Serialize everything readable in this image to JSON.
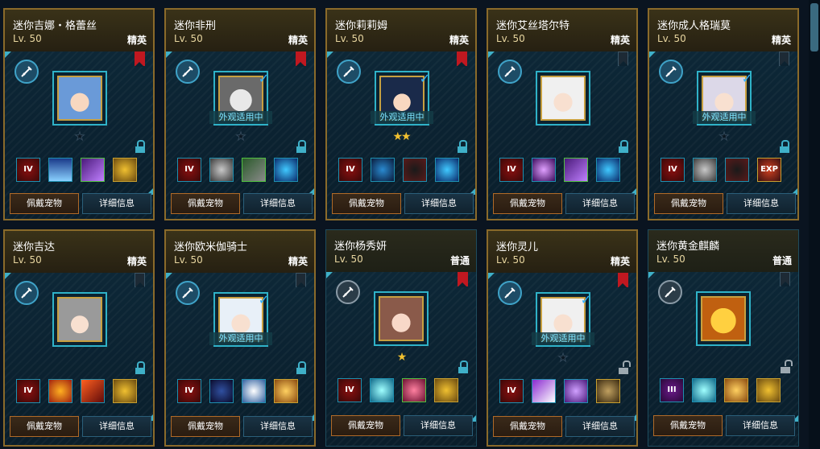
{
  "button_labels": {
    "equip": "佩戴宠物",
    "detail": "详细信息"
  },
  "applied_label": "外观适用中",
  "colors": {
    "accent": "#3fb0c8",
    "elite_border": "#8a6a2a",
    "red_ribbon": "#c01820",
    "star": "#f0c030"
  },
  "pets": [
    {
      "name": "迷你吉娜・格蕾丝",
      "level": "Lv. 50",
      "rank": "精英",
      "applied": false,
      "ribbon": "red",
      "stars": [
        false
      ],
      "lock": "closed",
      "class_icon": "sword-class-icon",
      "portrait": "blue-haired-girl",
      "skills": [
        {
          "icon": "rank-iv-icon",
          "text": "IV"
        },
        {
          "icon": "ice-spikes-skill-icon",
          "text": ""
        },
        {
          "icon": "purple-claw-skill-icon",
          "text": ""
        },
        {
          "icon": "gold-coin-skill-icon",
          "text": ""
        }
      ]
    },
    {
      "name": "迷你非刑",
      "level": "Lv. 50",
      "rank": "精英",
      "applied": true,
      "ribbon": "red",
      "stars": [
        false
      ],
      "lock": "closed",
      "class_icon": "sword-class-icon",
      "portrait": "masked-warrior",
      "skills": [
        {
          "icon": "rank-iv-icon",
          "text": "IV"
        },
        {
          "icon": "ghost-skill-icon",
          "text": ""
        },
        {
          "icon": "beast-skill-icon",
          "text": ""
        },
        {
          "icon": "blue-orb-skill-icon",
          "text": ""
        }
      ]
    },
    {
      "name": "迷你莉莉姆",
      "level": "Lv. 50",
      "rank": "精英",
      "applied": true,
      "ribbon": "red",
      "stars": [
        true,
        true
      ],
      "lock": "closed",
      "class_icon": "sword-class-icon",
      "portrait": "maid-girl",
      "skills": [
        {
          "icon": "rank-iv-icon",
          "text": "IV"
        },
        {
          "icon": "blue-swirl-skill-icon",
          "text": ""
        },
        {
          "icon": "shadow-silhouette-skill-icon",
          "text": ""
        },
        {
          "icon": "blue-orb-skill-icon",
          "text": ""
        }
      ]
    },
    {
      "name": "迷你艾丝塔尔特",
      "level": "Lv. 50",
      "rank": "精英",
      "applied": false,
      "ribbon": "dark",
      "stars": [],
      "lock": "closed",
      "class_icon": "sword-class-icon",
      "portrait": "white-haired-girl",
      "skills": [
        {
          "icon": "rank-iv-icon",
          "text": "IV"
        },
        {
          "icon": "purple-figure-skill-icon",
          "text": ""
        },
        {
          "icon": "purple-claw-skill-icon",
          "text": ""
        },
        {
          "icon": "blue-orb-skill-icon",
          "text": ""
        }
      ]
    },
    {
      "name": "迷你成人格瑞莫",
      "level": "Lv. 50",
      "rank": "精英",
      "applied": true,
      "ribbon": "dark",
      "stars": [
        false
      ],
      "lock": "closed",
      "class_icon": "sword-class-icon",
      "portrait": "silver-haired-girl",
      "skills": [
        {
          "icon": "rank-iv-icon",
          "text": "IV"
        },
        {
          "icon": "ghost-skill-icon",
          "text": ""
        },
        {
          "icon": "shadow-silhouette-skill-icon",
          "text": ""
        },
        {
          "icon": "exp-skill-icon",
          "text": "EXP"
        }
      ]
    },
    {
      "name": "迷你吉达",
      "level": "Lv. 50",
      "rank": "精英",
      "applied": false,
      "ribbon": "dark",
      "stars": [],
      "lock": "closed",
      "class_icon": "sword-class-icon",
      "portrait": "gray-hat-girl",
      "skills": [
        {
          "icon": "rank-iv-icon",
          "text": "IV"
        },
        {
          "icon": "fire-crest-skill-icon",
          "text": ""
        },
        {
          "icon": "fire-slash-skill-icon",
          "text": ""
        },
        {
          "icon": "gold-coin-skill-icon",
          "text": ""
        }
      ]
    },
    {
      "name": "迷你欧米伽骑士",
      "level": "Lv. 50",
      "rank": "精英",
      "applied": true,
      "ribbon": "dark",
      "stars": [],
      "lock": "closed",
      "class_icon": "sword-class-icon",
      "portrait": "white-haired-knight",
      "skills": [
        {
          "icon": "rank-iv-icon",
          "text": "IV"
        },
        {
          "icon": "blue-sigil-skill-icon",
          "text": ""
        },
        {
          "icon": "white-spirit-skill-icon",
          "text": ""
        },
        {
          "icon": "gold-fist-skill-icon",
          "text": ""
        }
      ]
    },
    {
      "name": "迷你杨秀妍",
      "level": "Lv. 50",
      "rank": "普通",
      "applied": false,
      "ribbon": "red",
      "stars": [
        true
      ],
      "lock": "closed",
      "class_icon": "sword-class-icon",
      "portrait": "brown-haired-girl",
      "skills": [
        {
          "icon": "rank-iv-icon",
          "text": "IV"
        },
        {
          "icon": "cyan-burst-skill-icon",
          "text": ""
        },
        {
          "icon": "pink-card-skill-icon",
          "text": ""
        },
        {
          "icon": "gold-coin-skill-icon",
          "text": ""
        }
      ]
    },
    {
      "name": "迷你灵儿",
      "level": "Lv. 50",
      "rank": "精英",
      "applied": true,
      "ribbon": "red",
      "stars": [
        false
      ],
      "lock": "open",
      "class_icon": "sword-class-icon",
      "portrait": "white-haired-girl",
      "skills": [
        {
          "icon": "rank-iv-icon",
          "text": "IV"
        },
        {
          "icon": "purple-blade-skill-icon",
          "text": ""
        },
        {
          "icon": "purple-feather-skill-icon",
          "text": ""
        },
        {
          "icon": "gold-gear-skill-icon",
          "text": ""
        }
      ]
    },
    {
      "name": "迷你黄金麒麟",
      "level": "Lv. 50",
      "rank": "普通",
      "applied": false,
      "ribbon": "dark",
      "stars": [],
      "lock": "open",
      "class_icon": "sword-class-icon",
      "portrait": "golden-kirin",
      "skills": [
        {
          "icon": "rank-iii-icon",
          "text": "III"
        },
        {
          "icon": "cyan-burst-skill-icon",
          "text": ""
        },
        {
          "icon": "gold-fist-skill-icon",
          "text": ""
        },
        {
          "icon": "gold-coin-skill-icon",
          "text": ""
        }
      ]
    }
  ]
}
